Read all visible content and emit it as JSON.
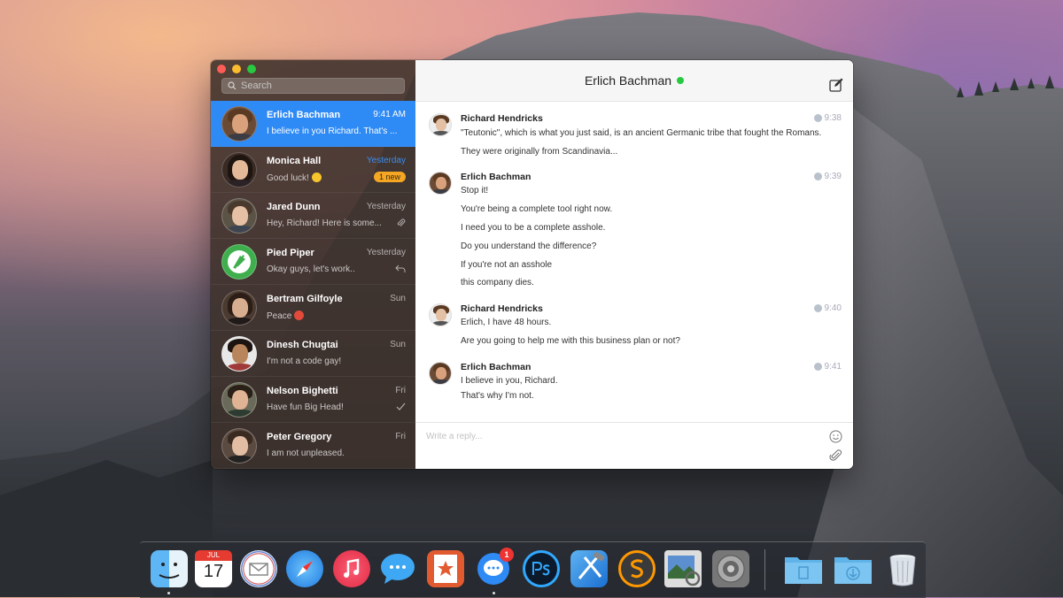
{
  "sidebar": {
    "search_placeholder": "Search",
    "conversations": [
      {
        "name": "Erlich Bachman",
        "preview": "I believe in you Richard. That's ...",
        "time": "9:41 AM",
        "active": true
      },
      {
        "name": "Monica Hall",
        "preview": "Good luck!",
        "time": "Yesterday",
        "badge": "1 new",
        "emoji": "smile"
      },
      {
        "name": "Jared Dunn",
        "preview": "Hey, Richard! Here is some...",
        "time": "Yesterday",
        "status": "paperclip-icon"
      },
      {
        "name": "Pied Piper",
        "preview": "Okay guys, let's work..",
        "time": "Yesterday",
        "status": "reply-icon"
      },
      {
        "name": "Bertram Gilfoyle",
        "preview": "Peace",
        "time": "Sun",
        "emoji": "devil"
      },
      {
        "name": "Dinesh Chugtai",
        "preview": "I'm not a code gay!",
        "time": "Sun"
      },
      {
        "name": "Nelson Bighetti",
        "preview": "Have fun Big Head!",
        "time": "Fri",
        "status": "checkmark-icon"
      },
      {
        "name": "Peter Gregory",
        "preview": "I am not unpleased.",
        "time": "Fri"
      }
    ]
  },
  "chat": {
    "title": "Erlich Bachman",
    "reply_placeholder": "Write a reply...",
    "messages": [
      {
        "sender": "Richard Hendricks",
        "time": "9:38",
        "source": "facebook-icon",
        "lines": [
          "\"Teutonic\", which is what you just said, is an ancient Germanic tribe that fought the Romans.",
          "They were originally from Scandinavia..."
        ]
      },
      {
        "sender": "Erlich Bachman",
        "time": "9:39",
        "source": "hangouts-icon",
        "lines": [
          "Stop it!",
          "You're being a complete tool right now.",
          "I need you to be a complete asshole.",
          "Do you understand the difference?",
          "If you're not an asshole",
          "this company dies."
        ]
      },
      {
        "sender": "Richard Hendricks",
        "time": "9:40",
        "source": "facebook-icon",
        "lines": [
          "Erlich, I have 48 hours.",
          "Are you going to help me with this business plan or not?"
        ]
      },
      {
        "sender": "Erlich Bachman",
        "time": "9:41",
        "source": "hangouts-icon",
        "lines": [
          "I believe in you, Richard.",
          "That's why I'm not."
        ]
      }
    ]
  },
  "dock": {
    "calendar_month": "JUL",
    "calendar_day": "17",
    "messenger_badge": "1",
    "items": [
      "finder-icon",
      "calendar-icon",
      "mail-icon",
      "safari-icon",
      "music-icon",
      "messages-icon",
      "wunderlist-icon",
      "messenger-icon",
      "photoshop-icon",
      "xcode-icon",
      "sublime-icon",
      "preview-icon",
      "system-preferences-icon",
      "documents-folder-icon",
      "downloads-folder-icon",
      "trash-icon"
    ]
  },
  "colors": {
    "accent": "#2e8af5",
    "online": "#27c93f",
    "badge": "#f5a623"
  }
}
